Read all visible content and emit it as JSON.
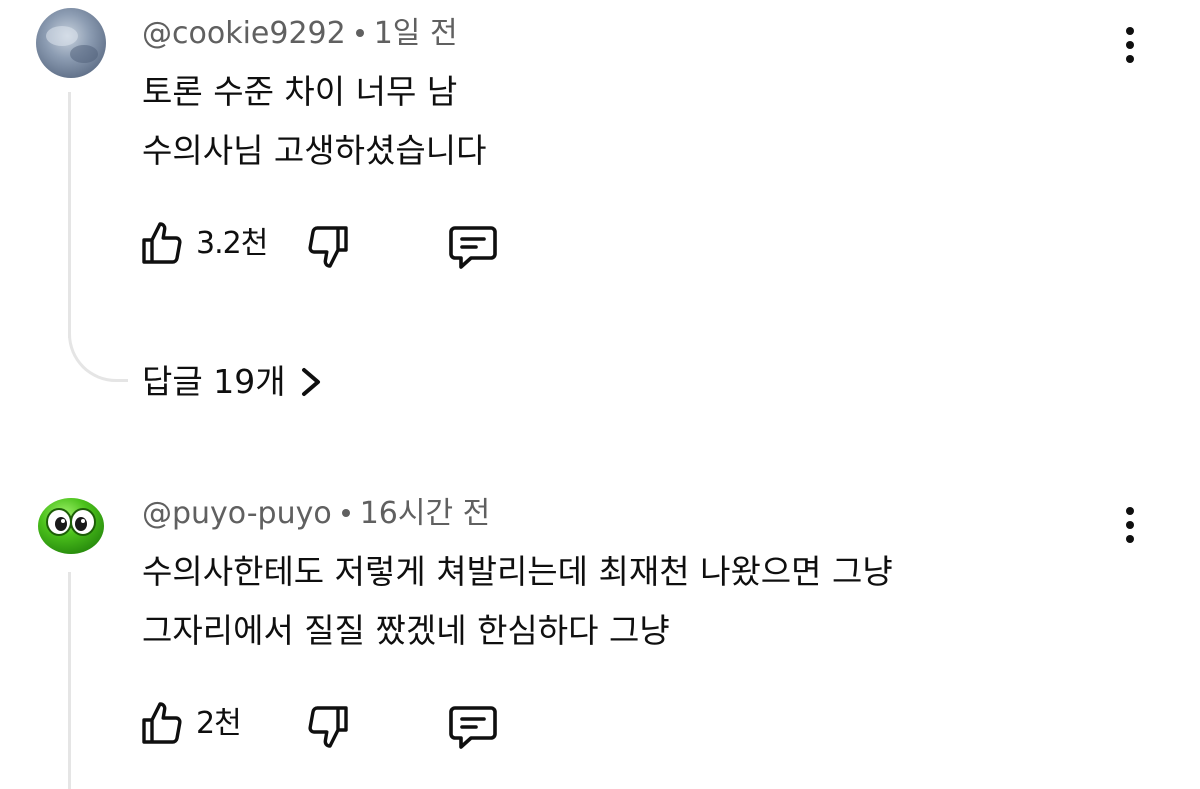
{
  "comments": [
    {
      "author": "@cookie9292",
      "time": "1일 전",
      "lines": [
        "토론 수준 차이 너무 남",
        "수의사님 고생하셨습니다"
      ],
      "likes": "3.2천",
      "replies_label": "답글 19개",
      "avatar_icon": "blurry-avatar",
      "avatar_colors": [
        "#7d8ea6",
        "#b9c4d2",
        "#5d6e88"
      ]
    },
    {
      "author": "@puyo-puyo",
      "time": "16시간 전",
      "lines": [
        "수의사한테도 저렇게 쳐발리는데 최재천 나왔으면 그냥",
        "그자리에서 질질 짰겠네 한심하다 그냥"
      ],
      "likes": "2천",
      "avatar_icon": "green-puyo-blob",
      "avatar_colors": [
        "#4cc21c",
        "#2a8f0e",
        "#ffffff"
      ]
    }
  ],
  "icons": {
    "like": "thumbs-up-icon",
    "dislike": "thumbs-down-icon",
    "reply": "comment-reply-icon",
    "more": "more-vert-icon",
    "chevron": "chevron-right-icon"
  },
  "colors": {
    "text": "#0f0f0f",
    "meta": "#606060",
    "thread_line": "#e5e5e5"
  }
}
